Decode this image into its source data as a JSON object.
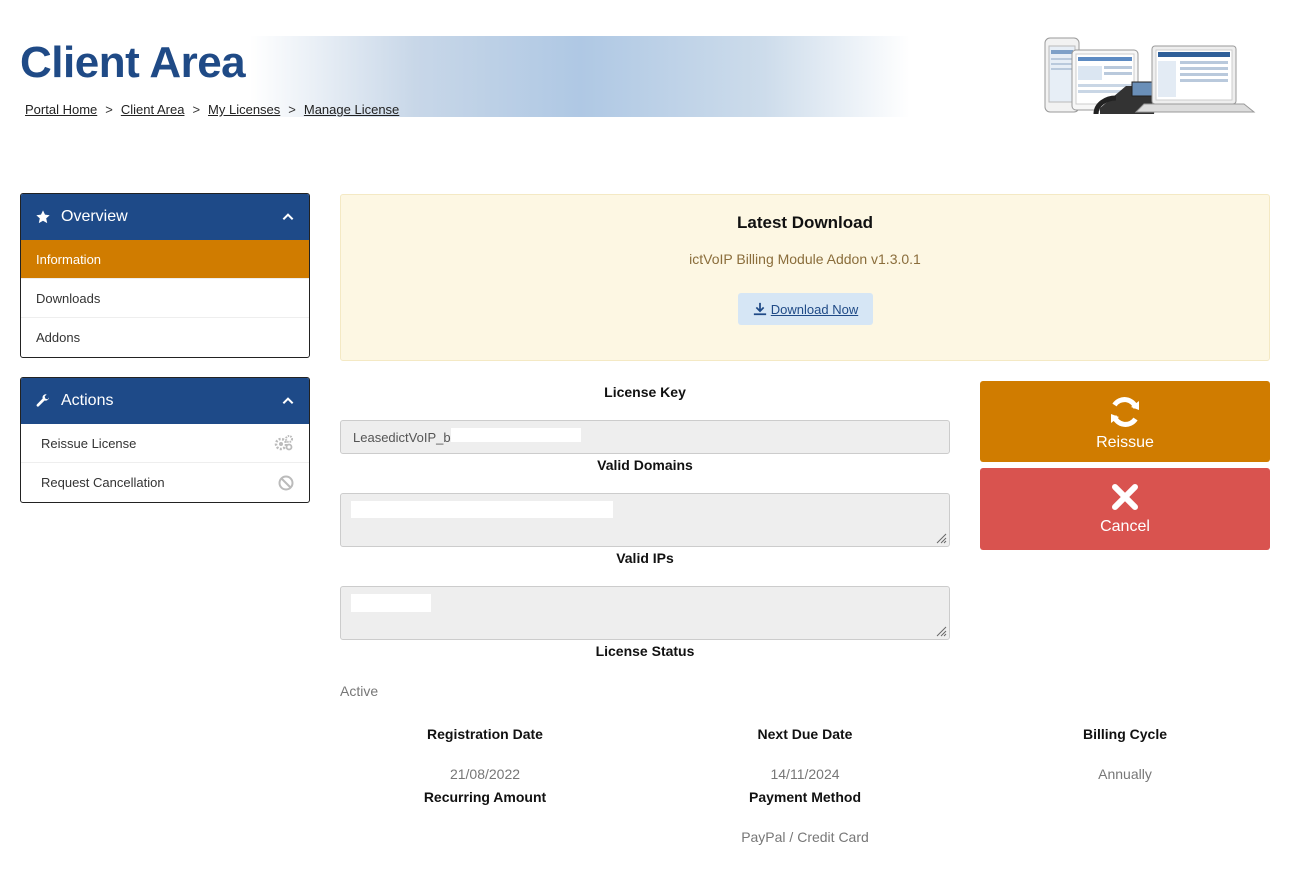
{
  "header": {
    "title": "Client Area",
    "breadcrumb": [
      "Portal Home",
      "Client Area",
      "My Licenses",
      "Manage License"
    ],
    "separator": ">"
  },
  "sidebar": {
    "overview": {
      "title": "Overview",
      "items": [
        {
          "label": "Information",
          "active": true
        },
        {
          "label": "Downloads",
          "active": false
        },
        {
          "label": "Addons",
          "active": false
        }
      ]
    },
    "actions": {
      "title": "Actions",
      "items": [
        {
          "label": "Reissue License",
          "icon": "gears-icon"
        },
        {
          "label": "Request Cancellation",
          "icon": "ban-icon"
        }
      ]
    }
  },
  "download": {
    "title": "Latest Download",
    "product": "ictVoIP Billing Module Addon v1.3.0.1",
    "button_label": "Download Now"
  },
  "license": {
    "key_label": "License Key",
    "key_value": "LeasedictVoIP_b",
    "domains_label": "Valid Domains",
    "ips_label": "Valid IPs",
    "status_label": "License Status",
    "status_value": "Active"
  },
  "buttons": {
    "reissue": "Reissue",
    "cancel": "Cancel"
  },
  "details": {
    "registration_date_label": "Registration Date",
    "registration_date": "21/08/2022",
    "next_due_label": "Next Due Date",
    "next_due": "14/11/2024",
    "billing_cycle_label": "Billing Cycle",
    "billing_cycle": "Annually",
    "recurring_label": "Recurring Amount",
    "payment_method_label": "Payment Method",
    "payment_method": "PayPal / Credit Card"
  },
  "colors": {
    "brand_blue": "#1e4a88",
    "accent_orange": "#d07c00",
    "danger_red": "#d9534f",
    "download_bg": "#fdf7e3"
  }
}
